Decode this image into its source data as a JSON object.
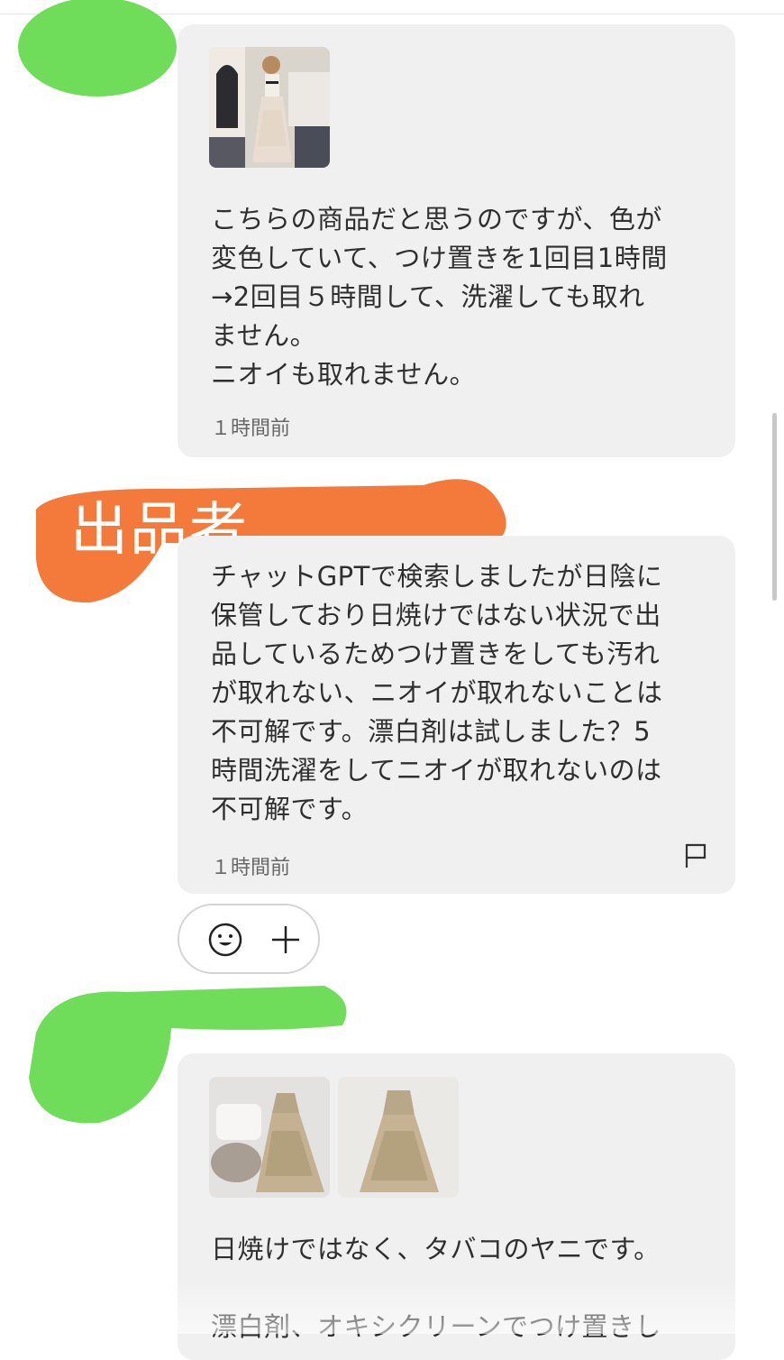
{
  "messages": [
    {
      "text": "こちらの商品だと思うのですが、色が\n変色していて、つけ置きを1回目1時間\n→2回目５時間して、洗濯しても取れ\nません。\nニオイも取れません。",
      "time": "１時間前"
    },
    {
      "sender_label": "出品者",
      "text": "チャットGPTで検索しましたが日陰に\n保管しており日焼けではない状況で出\n品しているためつけ置きをしても汚れ\nが取れない、ニオイが取れないことは\n不可解です。漂白剤は試しました？5\n時間洗濯をしてニオイが取れないのは\n不可解です。",
      "time": "１時間前"
    },
    {
      "text": "日焼けではなく、タバコのヤニです。\n\n漂白剤、オキシクリーンでつけ置きし"
    }
  ],
  "colors": {
    "bubble": "#f0f0f0",
    "redaction_green": "#6fdc5a",
    "seller_tag_orange": "#f47a3c"
  }
}
